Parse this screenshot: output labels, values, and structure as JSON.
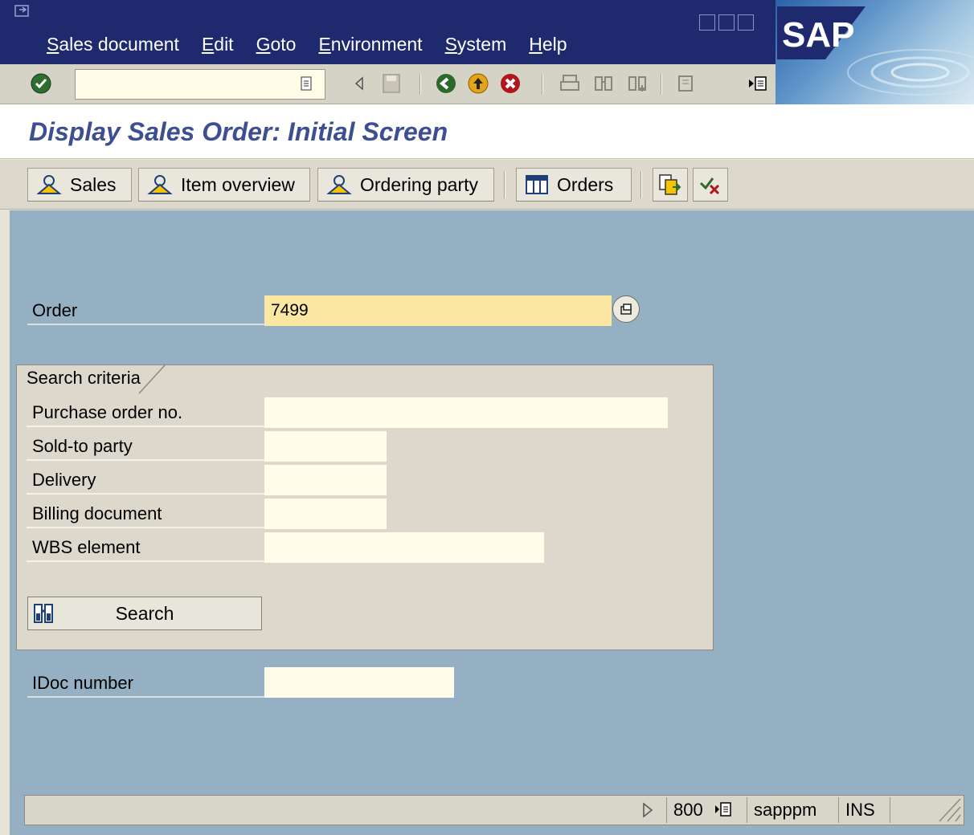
{
  "menubar": {
    "items": [
      "Sales document",
      "Edit",
      "Goto",
      "Environment",
      "System",
      "Help"
    ]
  },
  "brand": {
    "logo_text": "SAP"
  },
  "std_toolbar": {
    "command_value": ""
  },
  "screen": {
    "title": "Display Sales Order: Initial Screen"
  },
  "app_toolbar": {
    "sales": "Sales",
    "item_overview": "Item overview",
    "ordering_party": "Ordering party",
    "orders": "Orders"
  },
  "form": {
    "order_label": "Order",
    "order_value": "7499",
    "search_group_title": "Search criteria",
    "purchase_order_label": "Purchase order no.",
    "purchase_order_value": "",
    "sold_to_label": "Sold-to party",
    "sold_to_value": "",
    "delivery_label": "Delivery",
    "delivery_value": "",
    "billing_label": "Billing document",
    "billing_value": "",
    "wbs_label": "WBS element",
    "wbs_value": "",
    "search_button": "Search",
    "idoc_label": "IDoc number",
    "idoc_value": ""
  },
  "statusbar": {
    "client": "800",
    "server": "sapppm",
    "mode": "INS"
  },
  "colors": {
    "menubar_bg": "#1f2a6e",
    "title_text": "#3d4f91",
    "work_bg": "#94b0c2",
    "required_field": "#fbe7a1",
    "input_bg": "#fffde9"
  }
}
